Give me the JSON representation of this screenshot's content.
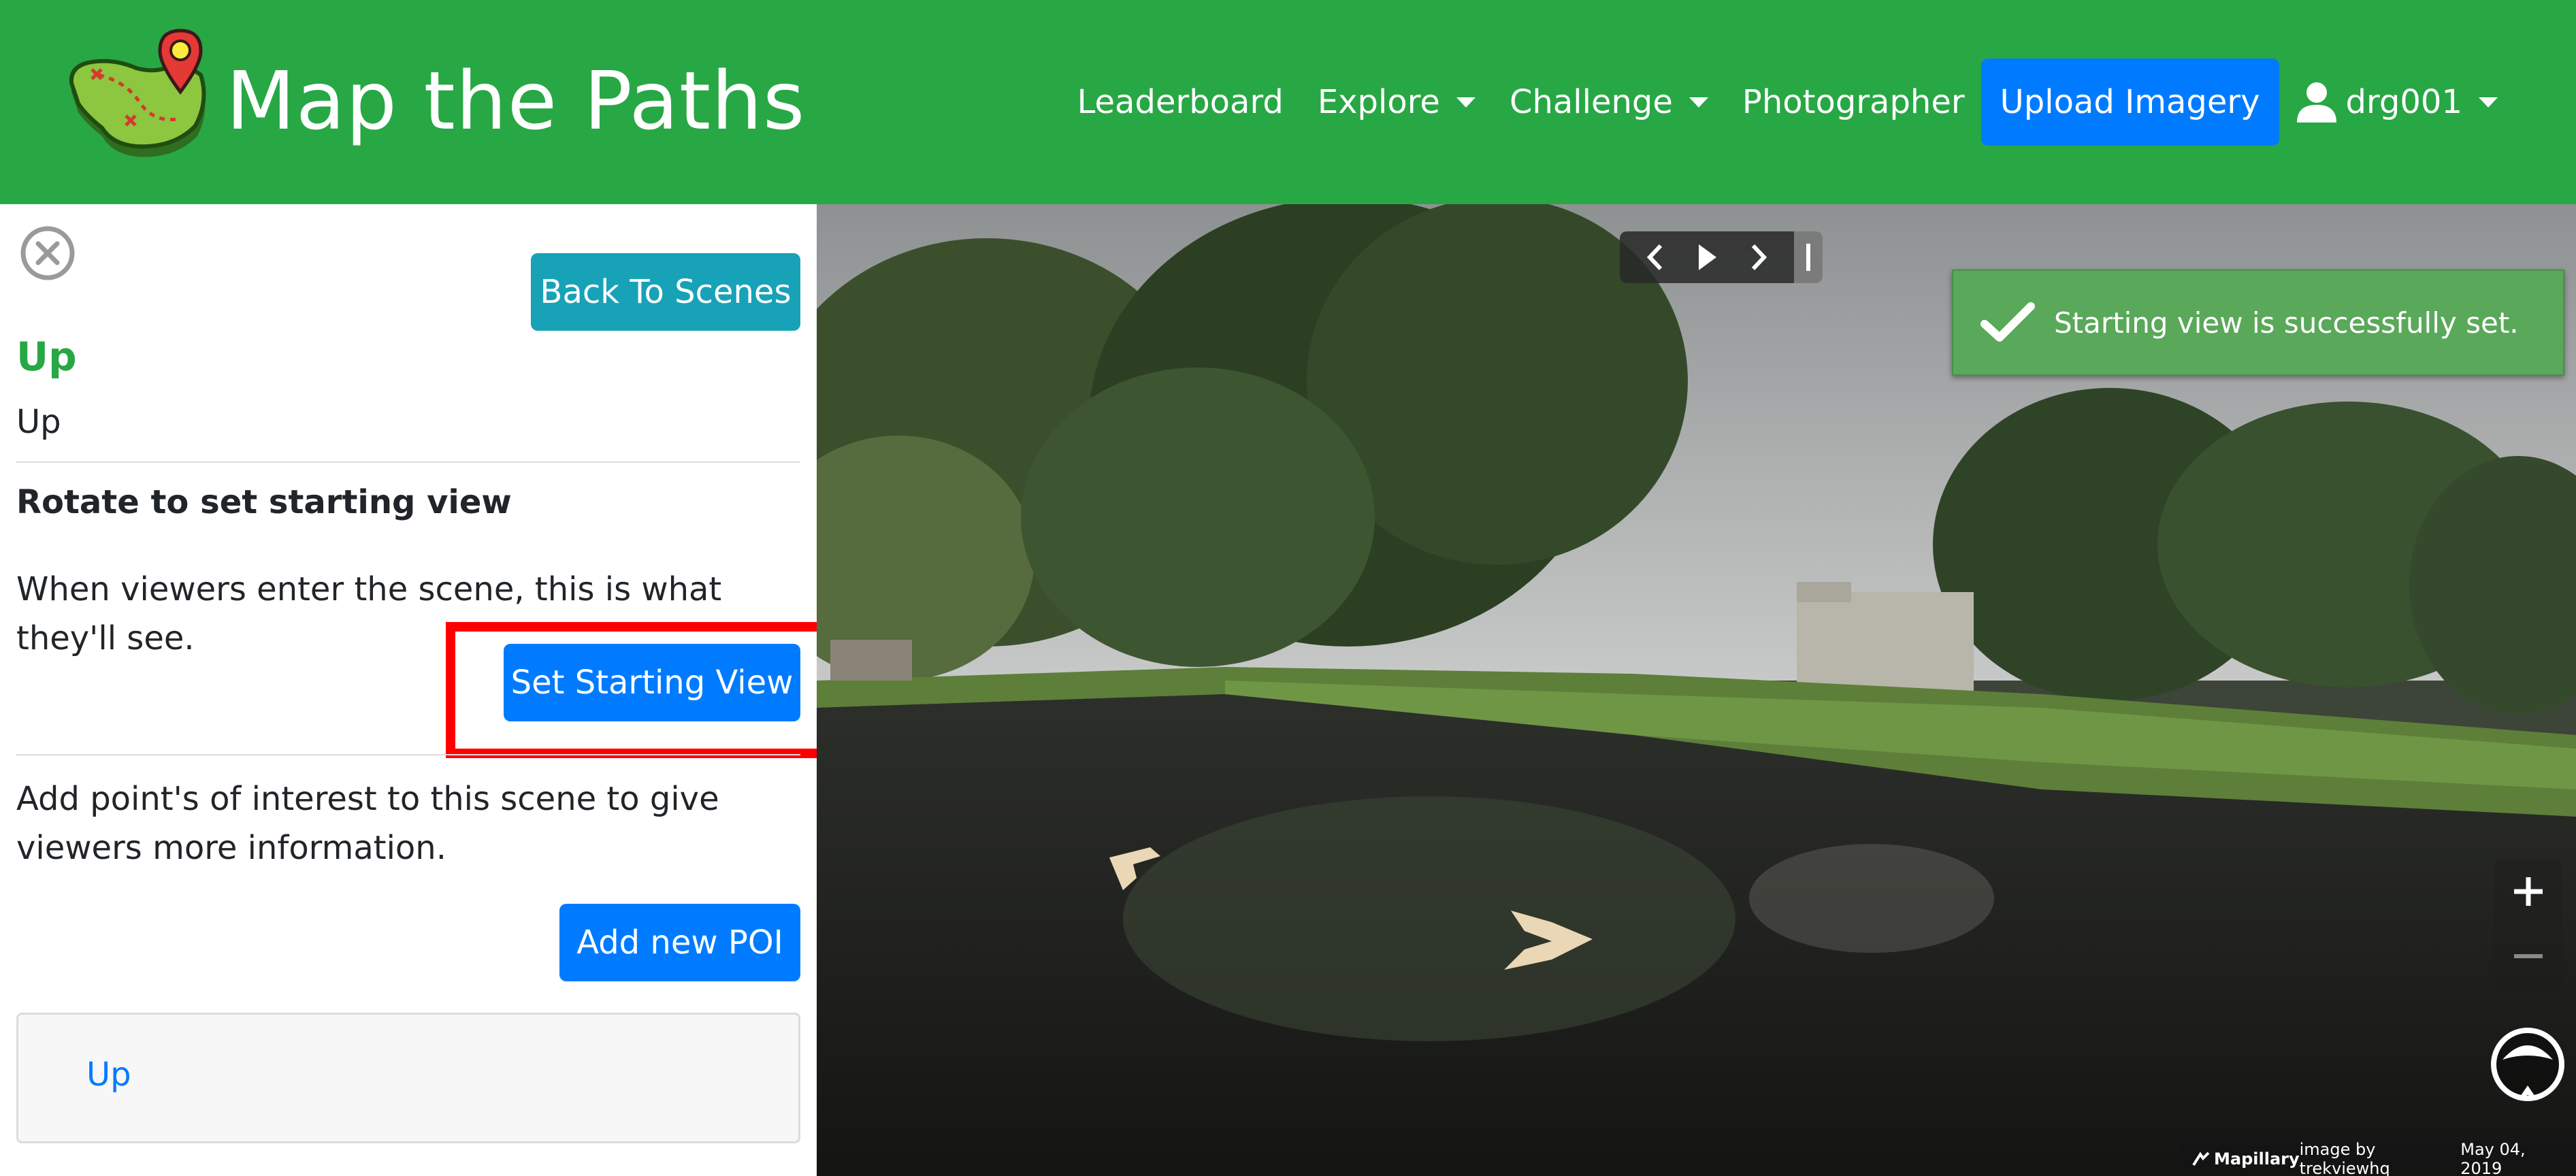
{
  "navbar": {
    "brand": "Map the Paths",
    "items": {
      "leaderboard": "Leaderboard",
      "explore": "Explore",
      "challenge": "Challenge",
      "photographer": "Photographer",
      "upload": "Upload Imagery",
      "user": "drg001"
    },
    "colors": {
      "bg": "#28a745",
      "upload_bg": "#007bff"
    }
  },
  "sidebar": {
    "back_button": "Back To Scenes",
    "title": "Up",
    "subtitle": "Up",
    "starting_view": {
      "heading": "Rotate to set starting view",
      "description": "When viewers enter the scene, this is what they'll see.",
      "button": "Set Starting View"
    },
    "poi": {
      "description": "Add point's of interest to this scene to give viewers more information.",
      "button": "Add new POI",
      "items": [
        "Up"
      ]
    }
  },
  "viewer": {
    "toast": "Starting view is successfully set.",
    "attribution": {
      "brand": "Mapillary",
      "credit": "image by trekviewhq",
      "date": "May 04, 2019"
    }
  }
}
